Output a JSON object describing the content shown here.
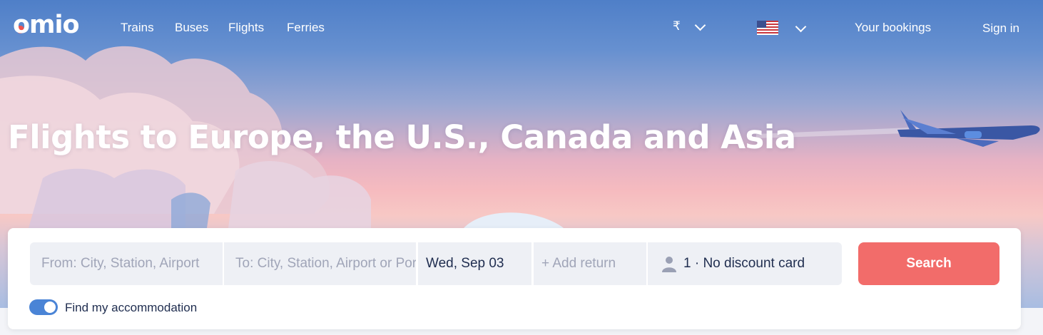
{
  "brand": {
    "logo_text": "omio",
    "accent": "#f1534e"
  },
  "nav": {
    "items": [
      "Trains",
      "Buses",
      "Flights",
      "Ferries"
    ]
  },
  "header": {
    "currency": "₹",
    "language_flag": "us-flag-icon",
    "bookings": "Your bookings",
    "sign_in": "Sign in"
  },
  "hero": {
    "title": "Flights to Europe, the U.S., Canada and Asia"
  },
  "search": {
    "from_placeholder": "From: City, Station, Airport",
    "to_placeholder": "To: City, Station, Airport or Port",
    "departure_date": "Wed, Sep 03",
    "return_placeholder": "+ Add return",
    "passengers": "1 · No discount card",
    "search_label": "Search",
    "search_color": "#f26c6a"
  },
  "accommodation": {
    "label": "Find my accommodation",
    "enabled": true
  }
}
